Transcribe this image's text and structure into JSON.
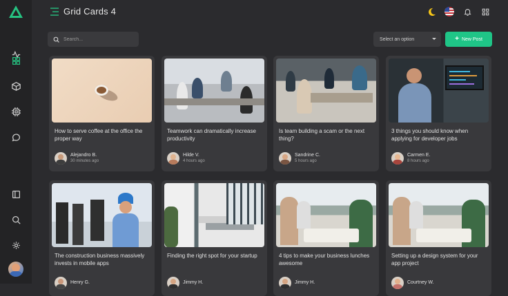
{
  "header": {
    "title": "Grid Cards 4"
  },
  "toolbar": {
    "search_placeholder": "Search...",
    "select_value": "Select an option",
    "new_post_label": "New Post"
  },
  "accent": "#1fc587",
  "sidebar": {
    "items": [
      {
        "icon": "activity-icon"
      },
      {
        "icon": "grid-icon"
      },
      {
        "icon": "box-icon"
      },
      {
        "icon": "chip-icon"
      },
      {
        "icon": "chat-icon"
      },
      {
        "icon": "panel-icon"
      },
      {
        "icon": "search-icon"
      },
      {
        "icon": "settings-icon"
      }
    ]
  },
  "cards": [
    {
      "title": "How to serve coffee at the office the proper way",
      "author": "Alejandro B.",
      "time": "30 minutes ago"
    },
    {
      "title": "Teamwork can dramatically increase productivity",
      "author": "Hilde V.",
      "time": "4 hours ago"
    },
    {
      "title": "Is team building a scam or the next thing?",
      "author": "Sandrine C.",
      "time": "5 hours ago"
    },
    {
      "title": "3 things you should know when applying for developer jobs",
      "author": "Carmen E.",
      "time": "8 hours ago"
    },
    {
      "title": "The construction business massively invests in mobile apps",
      "author": "Henry G.",
      "time": ""
    },
    {
      "title": "Finding the right spot for your startup",
      "author": "Jimmy H.",
      "time": ""
    },
    {
      "title": "4 tips to make your business lunches awesome",
      "author": "Jimmy H.",
      "time": ""
    },
    {
      "title": "Setting up a design system for your app project",
      "author": "Courtney W.",
      "time": ""
    }
  ]
}
